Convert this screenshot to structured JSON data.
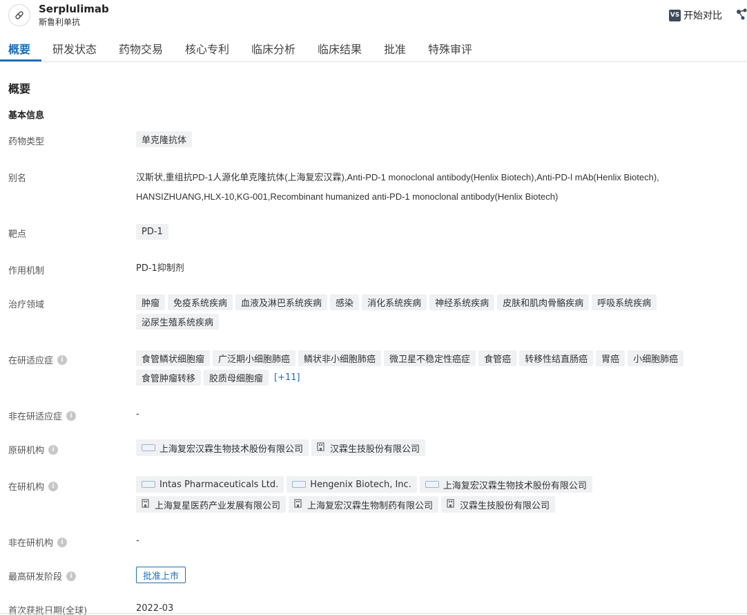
{
  "header": {
    "name": "Serplulimab",
    "subname": "斯鲁利单抗",
    "compare_badge": "VS",
    "compare_label": "开始对比"
  },
  "tabs": [
    "概要",
    "研发状态",
    "药物交易",
    "核心专利",
    "临床分析",
    "临床结果",
    "批准",
    "特殊审评"
  ],
  "section_title": "概要",
  "sub_title": "基本信息",
  "fields": {
    "drug_type": {
      "label": "药物类型",
      "tags": [
        "单克隆抗体"
      ]
    },
    "alias": {
      "label": "别名",
      "text": "汉斯状,重组抗PD-1人源化单克隆抗体(上海复宏汉霖),Anti-PD-1 monoclonal antibody(Henlix Biotech),Anti-PD-l mAb(Henlix Biotech), HANSIZHUANG,HLX-10,KG-001,Recombinant humanized anti-PD-1 monoclonal antibody(Henlix Biotech)"
    },
    "target": {
      "label": "靶点",
      "tags": [
        "PD-1"
      ]
    },
    "mechanism": {
      "label": "作用机制",
      "value": "PD-1抑制剂"
    },
    "therapy_area": {
      "label": "治疗领域",
      "tags": [
        "肿瘤",
        "免疫系统疾病",
        "血液及淋巴系统疾病",
        "感染",
        "消化系统疾病",
        "神经系统疾病",
        "皮肤和肌肉骨骼疾病",
        "呼吸系统疾病",
        "泌尿生殖系统疾病"
      ]
    },
    "indications": {
      "label": "在研适应症",
      "tags": [
        "食管鳞状细胞瘤",
        "广泛期小细胞肺癌",
        "鳞状非小细胞肺癌",
        "微卫星不稳定性癌症",
        "食管癌",
        "转移性结直肠癌",
        "胃癌",
        "小细胞肺癌",
        "食管肿瘤转移",
        "胶质母细胞瘤"
      ],
      "more": "[+11]"
    },
    "non_indications": {
      "label": "非在研适应症",
      "value": "-"
    },
    "originator": {
      "label": "原研机构",
      "orgs": [
        {
          "name": "上海复宏汉霖生物技术股份有限公司",
          "icon": "logo"
        },
        {
          "name": "汉霖生技股份有限公司",
          "icon": "doc"
        }
      ]
    },
    "active_orgs": {
      "label": "在研机构",
      "orgs": [
        {
          "name": "Intas Pharmaceuticals Ltd.",
          "icon": "logo"
        },
        {
          "name": "Hengenix Biotech, Inc.",
          "icon": "logo"
        },
        {
          "name": "上海复宏汉霖生物技术股份有限公司",
          "icon": "logo"
        },
        {
          "name": "上海复星医药产业发展有限公司",
          "icon": "doc"
        },
        {
          "name": "上海复宏汉霖生物制药有限公司",
          "icon": "doc"
        },
        {
          "name": "汉霖生技股份有限公司",
          "icon": "doc"
        }
      ]
    },
    "inactive_orgs": {
      "label": "非在研机构",
      "value": "-"
    },
    "highest_stage": {
      "label": "最高研发阶段",
      "value": "批准上市"
    },
    "first_approval": {
      "label": "首次获批日期(全球)",
      "value": "2022-03"
    }
  },
  "colors": {
    "accent": "#1f6fb5",
    "tag_bg": "#f0f1f3"
  }
}
